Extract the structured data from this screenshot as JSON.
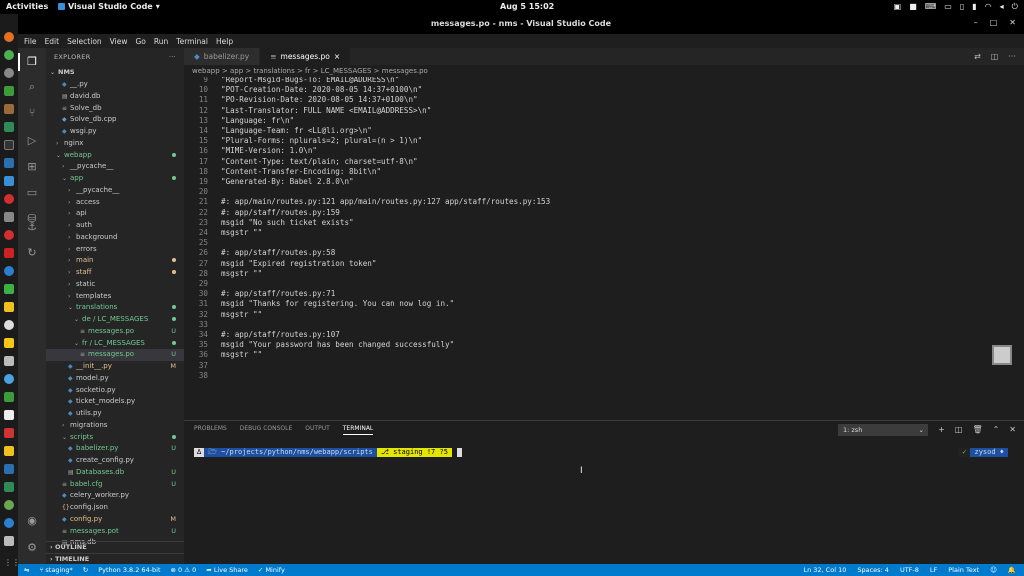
{
  "topbar": {
    "activities": "Activities",
    "app": "Visual Studio Code",
    "clock": "Aug 5  15:02"
  },
  "window": {
    "title": "messages.po - nms - Visual Studio Code"
  },
  "menu": [
    "File",
    "Edit",
    "Selection",
    "View",
    "Go",
    "Run",
    "Terminal",
    "Help"
  ],
  "explorer": {
    "header": "EXPLORER",
    "more": "···",
    "root": "NMS",
    "items": [
      {
        "label": "__.py",
        "indent": 1,
        "type": "file",
        "badge": ""
      },
      {
        "label": "david.db",
        "indent": 1,
        "type": "file",
        "badge": ""
      },
      {
        "label": "Solve_db",
        "indent": 1,
        "type": "file",
        "badge": ""
      },
      {
        "label": "Solve_db.cpp",
        "indent": 1,
        "type": "file",
        "badge": ""
      },
      {
        "label": "wsgi.py",
        "indent": 1,
        "type": "file",
        "badge": ""
      },
      {
        "label": "nginx",
        "indent": 0,
        "type": "folder",
        "badge": ""
      },
      {
        "label": "webapp",
        "indent": 0,
        "type": "folder-open",
        "badge": "dot",
        "color": "green"
      },
      {
        "label": "__pycache__",
        "indent": 1,
        "type": "folder",
        "badge": ""
      },
      {
        "label": "app",
        "indent": 1,
        "type": "folder-open",
        "badge": "dot",
        "color": "green"
      },
      {
        "label": "__pycache__",
        "indent": 2,
        "type": "folder",
        "badge": ""
      },
      {
        "label": "access",
        "indent": 2,
        "type": "folder",
        "badge": ""
      },
      {
        "label": "api",
        "indent": 2,
        "type": "folder",
        "badge": ""
      },
      {
        "label": "auth",
        "indent": 2,
        "type": "folder",
        "badge": ""
      },
      {
        "label": "background",
        "indent": 2,
        "type": "folder",
        "badge": ""
      },
      {
        "label": "errors",
        "indent": 2,
        "type": "folder",
        "badge": ""
      },
      {
        "label": "main",
        "indent": 2,
        "type": "folder",
        "badge": "dot-yellow",
        "color": "yellow"
      },
      {
        "label": "staff",
        "indent": 2,
        "type": "folder",
        "badge": "dot-yellow",
        "color": "yellow"
      },
      {
        "label": "static",
        "indent": 2,
        "type": "folder",
        "badge": ""
      },
      {
        "label": "templates",
        "indent": 2,
        "type": "folder",
        "badge": ""
      },
      {
        "label": "translations",
        "indent": 2,
        "type": "folder-open",
        "badge": "dot",
        "color": "green"
      },
      {
        "label": "de / LC_MESSAGES",
        "indent": 3,
        "type": "folder-open",
        "badge": "dot",
        "color": "green"
      },
      {
        "label": "messages.po",
        "indent": 4,
        "type": "file",
        "badge": "U",
        "color": "green"
      },
      {
        "label": "fr / LC_MESSAGES",
        "indent": 3,
        "type": "folder-open",
        "badge": "dot",
        "color": "green"
      },
      {
        "label": "messages.po",
        "indent": 4,
        "type": "file",
        "badge": "U",
        "color": "green",
        "selected": true
      },
      {
        "label": "__init__.py",
        "indent": 2,
        "type": "file",
        "badge": "M",
        "color": "yellow"
      },
      {
        "label": "model.py",
        "indent": 2,
        "type": "file",
        "badge": ""
      },
      {
        "label": "socketio.py",
        "indent": 2,
        "type": "file",
        "badge": ""
      },
      {
        "label": "ticket_models.py",
        "indent": 2,
        "type": "file",
        "badge": ""
      },
      {
        "label": "utils.py",
        "indent": 2,
        "type": "file",
        "badge": ""
      },
      {
        "label": "migrations",
        "indent": 1,
        "type": "folder",
        "badge": ""
      },
      {
        "label": "scripts",
        "indent": 1,
        "type": "folder-open",
        "badge": "dot",
        "color": "green"
      },
      {
        "label": "babelizer.py",
        "indent": 2,
        "type": "file",
        "badge": "U",
        "color": "green"
      },
      {
        "label": "create_config.py",
        "indent": 2,
        "type": "file",
        "badge": ""
      },
      {
        "label": "Databases.db",
        "indent": 2,
        "type": "file",
        "badge": "U",
        "color": "green"
      },
      {
        "label": "babel.cfg",
        "indent": 1,
        "type": "file",
        "badge": "U",
        "color": "green"
      },
      {
        "label": "celery_worker.py",
        "indent": 1,
        "type": "file",
        "badge": ""
      },
      {
        "label": "config.json",
        "indent": 1,
        "type": "file",
        "badge": ""
      },
      {
        "label": "config.py",
        "indent": 1,
        "type": "file",
        "badge": "M",
        "color": "yellow"
      },
      {
        "label": "messages.pot",
        "indent": 1,
        "type": "file",
        "badge": "U",
        "color": "green"
      },
      {
        "label": "nms.db",
        "indent": 1,
        "type": "file",
        "badge": ""
      }
    ],
    "outline": "OUTLINE",
    "timeline": "TIMELINE"
  },
  "tabs": [
    {
      "label": "babelizer.py",
      "active": false
    },
    {
      "label": "messages.po",
      "active": true,
      "close": "×"
    }
  ],
  "breadcrumb": "webapp > app > translations > fr > LC_MESSAGES > messages.po",
  "code": [
    {
      "n": "9",
      "t": "\"Report-Msgid-Bugs-To: EMAIL@ADDRESS\\n\""
    },
    {
      "n": "10",
      "t": "\"POT-Creation-Date: 2020-08-05 14:37+0100\\n\""
    },
    {
      "n": "11",
      "t": "\"PO-Revision-Date: 2020-08-05 14:37+0100\\n\""
    },
    {
      "n": "12",
      "t": "\"Last-Translator: FULL NAME <EMAIL@ADDRESS>\\n\""
    },
    {
      "n": "13",
      "t": "\"Language: fr\\n\""
    },
    {
      "n": "14",
      "t": "\"Language-Team: fr <LL@li.org>\\n\""
    },
    {
      "n": "15",
      "t": "\"Plural-Forms: nplurals=2; plural=(n > 1)\\n\""
    },
    {
      "n": "16",
      "t": "\"MIME-Version: 1.0\\n\""
    },
    {
      "n": "17",
      "t": "\"Content-Type: text/plain; charset=utf-8\\n\""
    },
    {
      "n": "18",
      "t": "\"Content-Transfer-Encoding: 8bit\\n\""
    },
    {
      "n": "19",
      "t": "\"Generated-By: Babel 2.8.0\\n\""
    },
    {
      "n": "20",
      "t": ""
    },
    {
      "n": "21",
      "t": "#: app/main/routes.py:121 app/main/routes.py:127 app/staff/routes.py:153"
    },
    {
      "n": "22",
      "t": "#: app/staff/routes.py:159"
    },
    {
      "n": "23",
      "t": "msgid \"No such ticket exists\""
    },
    {
      "n": "24",
      "t": "msgstr \"\""
    },
    {
      "n": "25",
      "t": ""
    },
    {
      "n": "26",
      "t": "#: app/staff/routes.py:58"
    },
    {
      "n": "27",
      "t": "msgid \"Expired registration token\""
    },
    {
      "n": "28",
      "t": "msgstr \"\""
    },
    {
      "n": "29",
      "t": ""
    },
    {
      "n": "30",
      "t": "#: app/staff/routes.py:71"
    },
    {
      "n": "31",
      "t": "msgid \"Thanks for registering. You can now log in.\""
    },
    {
      "n": "32",
      "t": "msgstr \"\""
    },
    {
      "n": "33",
      "t": ""
    },
    {
      "n": "34",
      "t": "#: app/staff/routes.py:107"
    },
    {
      "n": "35",
      "t": "msgid \"Your password has been changed successfully\""
    },
    {
      "n": "36",
      "t": "msgstr \"\""
    },
    {
      "n": "37",
      "t": ""
    },
    {
      "n": "38",
      "t": ""
    }
  ],
  "panel": {
    "tabs": [
      "PROBLEMS",
      "DEBUG CONSOLE",
      "OUTPUT",
      "TERMINAL"
    ],
    "terminal_select": "1: zsh",
    "prompt": {
      "seg1": "∆",
      "path": "~/projects/python/nms/webapp/scripts",
      "git": "⎇ staging !7 ?5",
      "right_a": "✓",
      "right_b": "zysod ♦"
    }
  },
  "status": {
    "branch": "staging*",
    "python": "Python 3.8.2 64-bit",
    "problems": "⊗ 0 ⚠ 0",
    "liveshare": "Live Share",
    "minify": "Minify",
    "position": "Ln 32, Col 10",
    "spaces": "Spaces: 4",
    "encoding": "UTF-8",
    "eol": "LF",
    "language": "Plain Text"
  },
  "colors": {
    "statusbar": "#007acc",
    "added": "#73c991",
    "modified": "#e2c08d"
  }
}
